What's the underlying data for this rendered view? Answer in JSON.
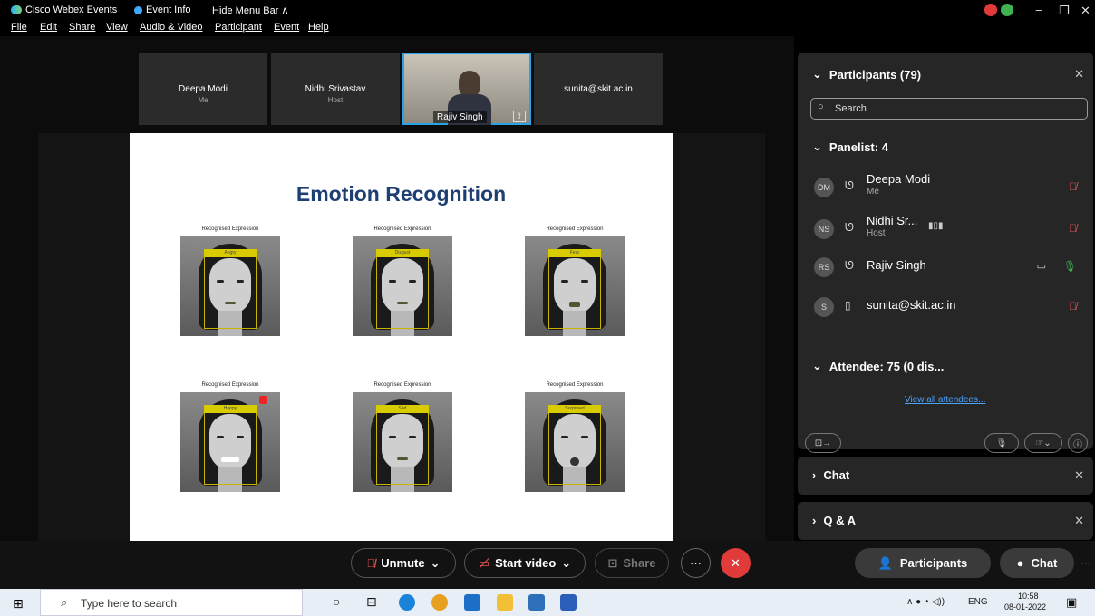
{
  "titlebar": {
    "app_name": "Cisco Webex Events",
    "event_info": "Event Info",
    "hide_menu": "Hide Menu Bar ∧",
    "menu": [
      "File",
      "Edit",
      "Share",
      "View",
      "Audio & Video",
      "Participant",
      "Event",
      "Help"
    ]
  },
  "thumbnails": [
    {
      "name": "Deepa Modi",
      "sub": "Me"
    },
    {
      "name": "Nidhi Srivastav",
      "sub": "Host"
    },
    {
      "name": "Rajiv Singh",
      "sub": ""
    },
    {
      "name": "sunita@skit.ac.in",
      "sub": ""
    }
  ],
  "slide": {
    "title": "Emotion Recognition",
    "caption": "Recognised Expression",
    "expressions": [
      "Angry",
      "Disgust",
      "Fear",
      "Happy",
      "Sad",
      "Surprised"
    ]
  },
  "controls": {
    "unmute": "Unmute",
    "start_video": "Start video",
    "share": "Share",
    "participants": "Participants",
    "chat": "Chat"
  },
  "panel": {
    "participants_title": "Participants (79)",
    "search_placeholder": "Search",
    "panelist_header": "Panelist: 4",
    "panelists": [
      {
        "initials": "DM",
        "name": "Deepa Modi",
        "role": "Me"
      },
      {
        "initials": "NS",
        "name": "Nidhi Sr...",
        "role": "Host"
      },
      {
        "initials": "RS",
        "name": "Rajiv Singh",
        "role": ""
      },
      {
        "initials": "S",
        "name": "sunita@skit.ac.in",
        "role": ""
      }
    ],
    "attendee_header": "Attendee: 75 (0 dis...",
    "view_all": "View all attendees...",
    "chat_title": "Chat",
    "qa_title": "Q & A"
  },
  "taskbar": {
    "search_placeholder": "Type here to search",
    "lang": "ENG",
    "time": "10:58",
    "date": "08-01-2022"
  },
  "colors": {
    "accent_red": "#e03a3a",
    "link_blue": "#4aa3ff",
    "slide_title": "#1e3f73"
  }
}
